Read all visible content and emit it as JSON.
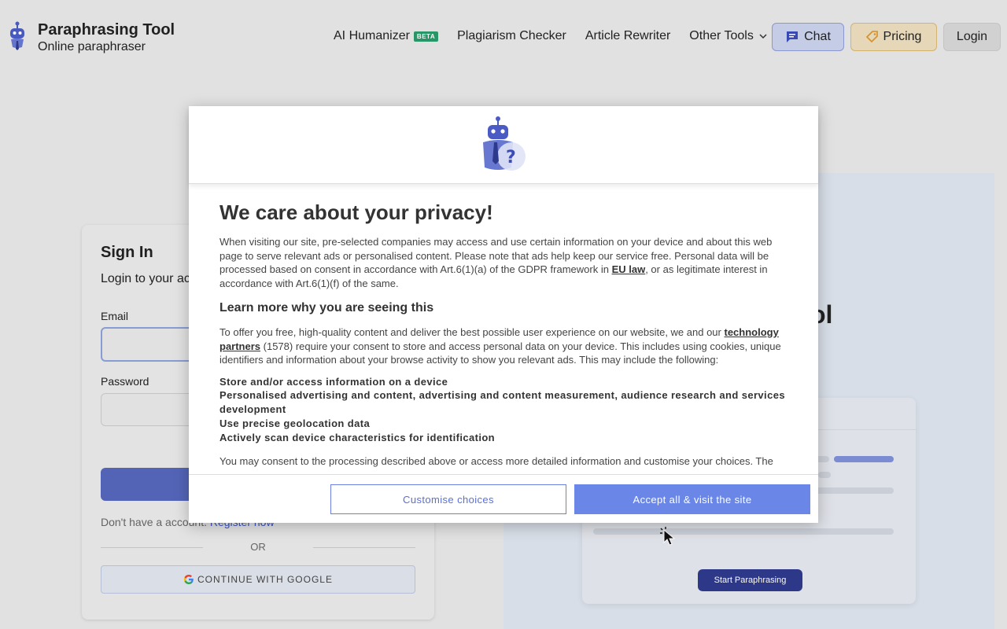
{
  "header": {
    "brand_title": "Paraphrasing Tool",
    "brand_subtitle": "Online paraphraser",
    "nav": {
      "ai_humanizer": "AI Humanizer",
      "beta_badge": "BETA",
      "plagiarism_checker": "Plagiarism Checker",
      "article_rewriter": "Article Rewriter",
      "other_tools": "Other Tools"
    },
    "chat_label": "Chat",
    "pricing_label": "Pricing",
    "login_label": "Login"
  },
  "signin": {
    "title": "Sign In",
    "subtitle": "Login to your ac",
    "email_label": "Email",
    "password_label": "Password",
    "register_prompt": "Don't have a account.",
    "register_link": "Register now",
    "or_label": "OR",
    "google_label": "CONTINUE WITH GOOGLE"
  },
  "promo": {
    "heading_fragment": "ol",
    "start_button": "Start Paraphrasing"
  },
  "consent": {
    "title": "We care about your privacy!",
    "intro_1": "When visiting our site, pre-selected companies may access and use certain information on your device and about this web page to serve relevant ads or personalised content. Please note that ads help keep our service free. Personal data will be processed based on consent in accordance with Art.6(1)(a) of the GDPR framework in ",
    "intro_link": "EU law",
    "intro_2": ", or as legitimate interest in accordance with Art.6(1)(f) of the same.",
    "learn_heading": "Learn more why you are seeing this",
    "partners_1": "To offer you free, high-quality content and deliver the best possible user experience on our website, we and our ",
    "partners_link": "technology partners",
    "partners_2": " (1578) require your consent to store and access personal data on your device. This includes using cookies, unique identifiers and information about your browse activity to show you relevant ads. This may include the following:",
    "purposes": [
      "Store and/or access information on a device",
      "Personalised advertising and content, advertising and content measurement, audience research and services development",
      "Use precise geolocation data",
      "Actively scan device characteristics for identification"
    ],
    "closing": "You may consent to the processing described above or access more detailed information and customise your choices. The",
    "customise_label": "Customise choices",
    "accept_label": "Accept all & visit the site"
  },
  "colors": {
    "accent": "#6a86e6",
    "chat_bg": "#c9d1ea",
    "pricing_bg": "#eadcbc",
    "beta": "#2a9a6a"
  },
  "icons": [
    "robot-logo-icon",
    "chat-bubble-icon",
    "price-tag-icon",
    "chevron-down-icon",
    "google-icon",
    "robot-question-icon",
    "pointer-cursor-icon"
  ]
}
